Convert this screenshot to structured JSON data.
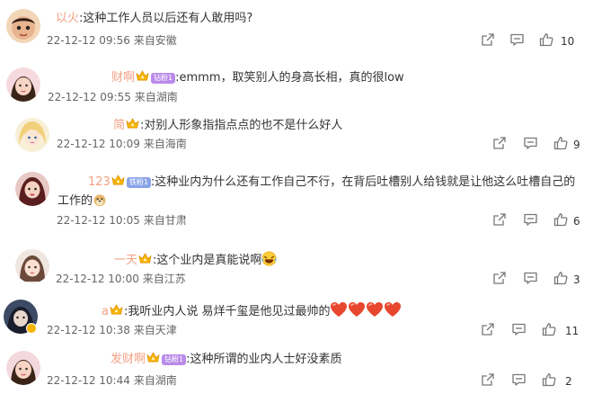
{
  "comments": [
    {
      "user": "&nbsp;",
      "user_text": "以火",
      "text": ":这种工作人员以后还有人敢用吗?",
      "date": "22-12-12 09:56",
      "source": "来自安徽",
      "likes": "10",
      "crown": false,
      "badge": ""
    },
    {
      "user_text": "财啊",
      "text": ":emmm，取笑别人的身高长相，真的很low",
      "date": "22-12-12 09:55",
      "source": "来自湖南",
      "likes": "",
      "crown": true,
      "badge": "钻粉1"
    },
    {
      "user_text": "简",
      "text": ":对别人形象指指点点的也不是什么好人",
      "date": "22-12-12 10:09",
      "source": "来自海南",
      "likes": "9",
      "crown": true,
      "badge": ""
    },
    {
      "user_text": "123",
      "text": ":这种业内为什么还有工作自己不行，在背后吐槽别人给钱就是让他这么吐槽自己的工作的",
      "date": "22-12-12 10:05",
      "source": "来自甘肃",
      "likes": "6",
      "crown": true,
      "badge": "铁粉1"
    },
    {
      "user_text": "一天",
      "text": ":这个业内是真能说啊",
      "date": "22-12-12 10:00",
      "source": "来自江苏",
      "likes": "3",
      "crown": true,
      "badge": ""
    },
    {
      "user_text": "a",
      "text": ":我听业内人说 易烊千玺是他见过最帅的",
      "date": "22-12-12 10:38",
      "source": "来自天津",
      "likes": "11",
      "crown": true,
      "badge": ""
    },
    {
      "user_text": "发财啊",
      "text": ":这种所谓的业内人士好没素质",
      "date": "22-12-12 10:44",
      "source": "来自湖南",
      "likes": "2",
      "crown": true,
      "badge": "钻粉1"
    }
  ],
  "icons": {
    "share": "share-icon",
    "comment": "comment-icon",
    "like": "thumbs-up-icon",
    "crown": "crown-icon",
    "heart": "heart-icon",
    "laugh": "laughing-emoji-icon",
    "doge": "doge-emoji-icon"
  },
  "colors": {
    "username": "#eb7350",
    "meta": "#666666",
    "badge_diamond": "#b98ae9",
    "badge_iron": "#8aa4e8",
    "heart": "#e8472f"
  }
}
